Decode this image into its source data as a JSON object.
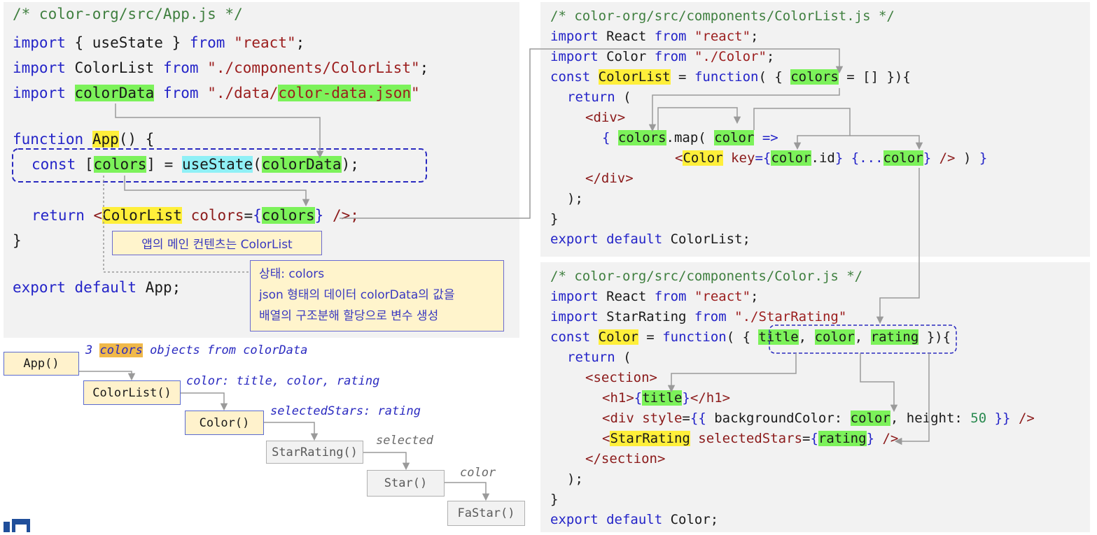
{
  "app_code": {
    "comment": "/* color-org/src/App.js */",
    "line2": [
      "import",
      " { useState } ",
      "from",
      " ",
      "\"react\"",
      ";"
    ],
    "line3": [
      "import",
      " ColorList ",
      "from",
      " ",
      "\"./components/ColorList\"",
      ";"
    ],
    "line4": [
      "import",
      " ",
      "colorData",
      " ",
      "from",
      " ",
      "\"./data/",
      "color-data.json",
      "\""
    ],
    "line5": [
      "function",
      " ",
      "App",
      "() {"
    ],
    "line6": [
      "const",
      " [",
      "colors",
      "] = ",
      "useState",
      "(",
      "colorData",
      ");"
    ],
    "line7": [
      "return",
      " <",
      "ColorList",
      " ",
      "colors",
      "=",
      "{",
      "colors",
      "}",
      " />;"
    ],
    "line8": "}",
    "line9": [
      "export",
      " ",
      "default",
      " App;"
    ]
  },
  "app_notes": {
    "note1": "앱의 메인 컨텐츠는 ColorList",
    "note2_line1": "상태: colors",
    "note2_line2": "json 형태의 데이터 colorData의 값을",
    "note2_line3": "배열의 구조분해 할당으로 변수 생성"
  },
  "colorlist_code": {
    "comment": "/* color-org/src/components/ColorList.js */",
    "line2": [
      "import",
      " React ",
      "from",
      " ",
      "\"react\"",
      ";"
    ],
    "line3": [
      "import",
      " Color ",
      "from",
      " ",
      "\"./Color\"",
      ";"
    ],
    "line4": [
      "const",
      " ",
      "ColorList",
      " = ",
      "function",
      "( { ",
      "colors",
      " = [] }){"
    ],
    "line5": [
      "return",
      " ("
    ],
    "line6": "<div>",
    "line7": [
      "{",
      " ",
      "colors",
      ".map( ",
      "color",
      " =>"
    ],
    "line8": [
      "<",
      "Color",
      " ",
      "key",
      "={",
      "color",
      ".id",
      "}",
      " {...",
      "color",
      "}",
      " />",
      " ) ",
      "}"
    ],
    "line9": "</div>",
    "line10": ");",
    "line11": "}",
    "line12": [
      "export",
      " ",
      "default",
      " ColorList;"
    ]
  },
  "color_code": {
    "comment": "/* color-org/src/components/Color.js */",
    "line2": [
      "import",
      " React ",
      "from",
      " ",
      "\"react\"",
      ";"
    ],
    "line3": [
      "import",
      " StarRating ",
      "from",
      " ",
      "\"./StarRating\""
    ],
    "line4": [
      "const",
      " ",
      "Color",
      " = ",
      "function",
      "( { ",
      "title",
      ", ",
      "color",
      ", ",
      "rating",
      " }){"
    ],
    "line5": [
      "return",
      " ("
    ],
    "line6": "<section>",
    "line7": [
      "<h1>",
      "{",
      "title",
      "}",
      "</h1>"
    ],
    "line8": [
      "<div",
      " ",
      "style",
      "=",
      "{{",
      " backgroundColor: ",
      "color",
      ", height: ",
      "50",
      " ",
      "}}",
      " />"
    ],
    "line9": [
      "<",
      "StarRating",
      " ",
      "selectedStars",
      "=",
      "{",
      "rating",
      "}",
      " />"
    ],
    "line10": "</section>",
    "line11": ");",
    "line12": "}",
    "line13": [
      "export",
      " ",
      "default",
      " Color;"
    ]
  },
  "tree": {
    "nodes": [
      "App()",
      "ColorList()",
      "Color()",
      "StarRating()",
      "Star()",
      "FaStar()"
    ],
    "label1_pre": "3 ",
    "label1_hl": "colors",
    "label1_post": " objects from colorData",
    "label2": "color: title, color, rating",
    "label3": "selectedStars: rating",
    "label4": "selected",
    "label5": "color"
  },
  "colors": {
    "panel_bg": "#f2f2f2",
    "comment": "#3f7f3f",
    "keyword": "#2424c8",
    "string": "#9b1d1d",
    "highlight_green": "#7cf25a",
    "highlight_yellow": "#ffef3a",
    "highlight_cyan": "#8ff0f6",
    "dashed_box": "#2a2ac0"
  }
}
